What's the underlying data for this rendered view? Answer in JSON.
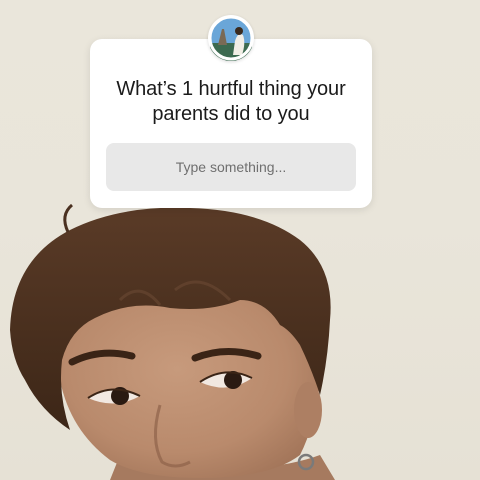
{
  "question_sticker": {
    "question": "What’s 1 hurtful thing your parents did to you",
    "answer_placeholder": "Type something..."
  },
  "icons": {
    "avatar": "profile-photo-avatar"
  },
  "colors": {
    "sticker_background": "#ffffff",
    "field_background": "#e8e8e8",
    "placeholder_text": "#6f6f6f",
    "question_text": "#1b1b1b",
    "backdrop_wall": "#e9e5da",
    "hair": "#4a3020"
  }
}
